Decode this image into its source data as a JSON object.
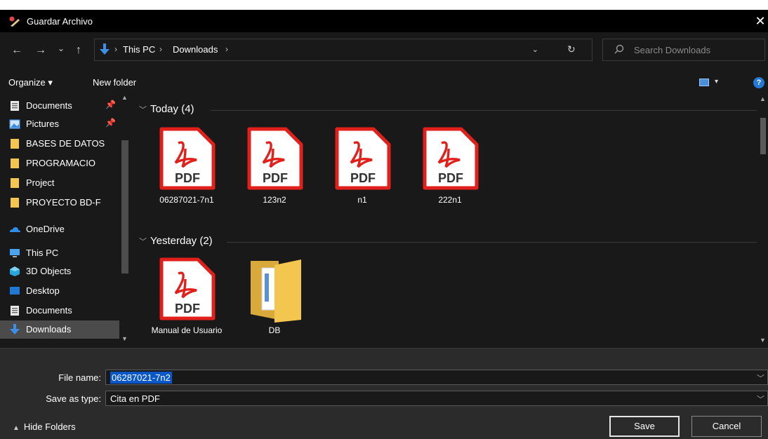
{
  "window": {
    "title": "Guardar Archivo",
    "close_glyph": "✕"
  },
  "nav": {
    "back_glyph": "←",
    "forward_glyph": "→",
    "recent_glyph": "⌄",
    "up_glyph": "↑",
    "breadcrumbs": [
      "This PC",
      "Downloads"
    ],
    "crumb_separator": "›",
    "dropdown_glyph": "⌄",
    "refresh_glyph": "↻",
    "search_placeholder": "Search Downloads"
  },
  "toolbar": {
    "organize": "Organize ▾",
    "new_folder": "New folder",
    "view_drop": "▾",
    "help": "?"
  },
  "sidebar": {
    "items": [
      {
        "label": "Documents",
        "icon": "documents-icon",
        "pinned": true
      },
      {
        "label": "Pictures",
        "icon": "pictures-icon",
        "pinned": true
      },
      {
        "label": "BASES DE DATOS",
        "icon": "folder-icon"
      },
      {
        "label": "PROGRAMACIO",
        "icon": "folder-icon"
      },
      {
        "label": "Project",
        "icon": "folder-icon"
      },
      {
        "label": "PROYECTO BD-F",
        "icon": "folder-icon"
      },
      {
        "label": "OneDrive",
        "icon": "onedrive-icon"
      },
      {
        "label": "This PC",
        "icon": "this-pc-icon"
      },
      {
        "label": "3D Objects",
        "icon": "3d-objects-icon"
      },
      {
        "label": "Desktop",
        "icon": "desktop-icon"
      },
      {
        "label": "Documents",
        "icon": "documents-icon"
      },
      {
        "label": "Downloads",
        "icon": "downloads-icon",
        "selected": true
      }
    ]
  },
  "groups": [
    {
      "label": "Today (4)",
      "files": [
        "06287021-7n1",
        "123n2",
        "n1",
        "222n1"
      ]
    },
    {
      "label": "Yesterday (2)",
      "files": [
        "Manual de Usuario",
        "DB"
      ]
    }
  ],
  "pdf_label": "PDF",
  "bottom": {
    "file_name_label": "File name:",
    "file_name_value": "06287021-7n2",
    "save_type_label": "Save as type:",
    "save_type_value": "Cita en PDF",
    "hide_folders": "Hide Folders",
    "save": "Save",
    "cancel": "Cancel"
  },
  "colors": {
    "background": "#191919",
    "titlebar": "#000000",
    "selection": "#0a58c7",
    "pdf_red": "#e1201b",
    "folder": "#f3c64f"
  }
}
